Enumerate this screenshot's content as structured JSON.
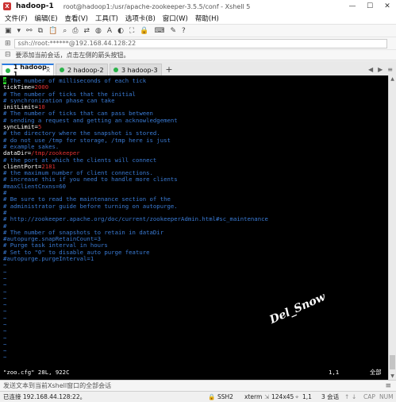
{
  "window": {
    "tab_name": "hadoop-1",
    "path": "root@hadoop1:/usr/apache-zookeeper-3.5.5/conf - Xshell 5",
    "min": "—",
    "max": "☐",
    "close": "✕"
  },
  "menu": [
    "文件(F)",
    "编辑(E)",
    "查看(V)",
    "工具(T)",
    "选项卡(B)",
    "窗口(W)",
    "帮助(H)"
  ],
  "toolbar_icons": [
    "new-session-icon",
    "open-icon",
    "link-icon",
    "copy-icon",
    "paste-icon",
    "find-icon",
    "print-icon",
    "transfer-icon",
    "globe-icon",
    "font-icon",
    "color-icon",
    "fullscreen-icon",
    "lock-icon",
    "keyboard-icon",
    "compose-icon",
    "help-icon"
  ],
  "address": {
    "value": "ssh://root:******@192.168.44.128:22"
  },
  "notice": {
    "text": "要添加当前会话，点击左侧的箭头按钮。"
  },
  "tabs": [
    {
      "label": "1 hadoop-1",
      "active": true
    },
    {
      "label": "2 hadoop-2",
      "active": false
    },
    {
      "label": "3 hadoop-3",
      "active": false
    }
  ],
  "tab_add": "+",
  "terminal": {
    "lines": [
      [
        [
          "cursor",
          "#"
        ],
        [
          "c",
          " The number of milliseconds of each tick"
        ]
      ],
      [
        [
          "w",
          "tickTime="
        ],
        [
          "r",
          "2000"
        ]
      ],
      [
        [
          "c",
          "# The number of ticks that the initial"
        ]
      ],
      [
        [
          "c",
          "# synchronization phase can take"
        ]
      ],
      [
        [
          "w",
          "initLimit="
        ],
        [
          "r",
          "10"
        ]
      ],
      [
        [
          "c",
          "# The number of ticks that can pass between"
        ]
      ],
      [
        [
          "c",
          "# sending a request and getting an acknowledgement"
        ]
      ],
      [
        [
          "w",
          "syncLimit="
        ],
        [
          "r",
          "5"
        ]
      ],
      [
        [
          "c",
          "# the directory where the snapshot is stored."
        ]
      ],
      [
        [
          "c",
          "# do not use /tmp for storage, /tmp here is just"
        ]
      ],
      [
        [
          "c",
          "# example sakes."
        ]
      ],
      [
        [
          "w",
          "dataDir="
        ],
        [
          "r",
          "/tmp/zookeeper"
        ]
      ],
      [
        [
          "c",
          "# the port at which the clients will connect"
        ]
      ],
      [
        [
          "w",
          "clientPort="
        ],
        [
          "r",
          "2181"
        ]
      ],
      [
        [
          "c",
          "# the maximum number of client connections."
        ]
      ],
      [
        [
          "c",
          "# increase this if you need to handle more clients"
        ]
      ],
      [
        [
          "c",
          "#maxClientCnxns=60"
        ]
      ],
      [
        [
          "c",
          "#"
        ]
      ],
      [
        [
          "c",
          "# Be sure to read the maintenance section of the"
        ]
      ],
      [
        [
          "c",
          "# administrator guide before turning on autopurge."
        ]
      ],
      [
        [
          "c",
          "#"
        ]
      ],
      [
        [
          "c",
          "# http://zookeeper.apache.org/doc/current/zookeeperAdmin.html#sc_maintenance"
        ]
      ],
      [
        [
          "c",
          "#"
        ]
      ],
      [
        [
          "c",
          "# The number of snapshots to retain in dataDir"
        ]
      ],
      [
        [
          "c",
          "#autopurge.snapRetainCount=3"
        ]
      ],
      [
        [
          "c",
          "# Purge task interval in hours"
        ]
      ],
      [
        [
          "c",
          "# Set to \"0\" to disable auto purge feature"
        ]
      ],
      [
        [
          "c",
          "#autopurge.purgeInterval=1"
        ]
      ],
      [
        [
          "tilde",
          "~"
        ]
      ],
      [
        [
          "tilde",
          "~"
        ]
      ],
      [
        [
          "tilde",
          "~"
        ]
      ],
      [
        [
          "tilde",
          "~"
        ]
      ],
      [
        [
          "tilde",
          "~"
        ]
      ],
      [
        [
          "tilde",
          "~"
        ]
      ],
      [
        [
          "tilde",
          "~"
        ]
      ],
      [
        [
          "tilde",
          "~"
        ]
      ],
      [
        [
          "tilde",
          "~"
        ]
      ],
      [
        [
          "tilde",
          "~"
        ]
      ],
      [
        [
          "tilde",
          "~"
        ]
      ],
      [
        [
          "tilde",
          "~"
        ]
      ],
      [
        [
          "tilde",
          "~"
        ]
      ],
      [
        [
          "tilde",
          "~"
        ]
      ],
      [
        [
          "tilde",
          "~"
        ]
      ]
    ],
    "status_file": "\"zoo.cfg\" 28L, 922C",
    "status_pos": "1,1",
    "status_all": "全部"
  },
  "watermark": "Del_Snow",
  "sendbar": {
    "text": "发送文本到当前Xshell窗口的全部会话"
  },
  "statusbar": {
    "connected": "已连接 192.168.44.128:22。",
    "protocol": "SSH2",
    "terminal": "xterm",
    "size": "124x45",
    "cursor": "1,1",
    "sessions": "3 会话",
    "cap": "CAP",
    "num": "NUM"
  }
}
